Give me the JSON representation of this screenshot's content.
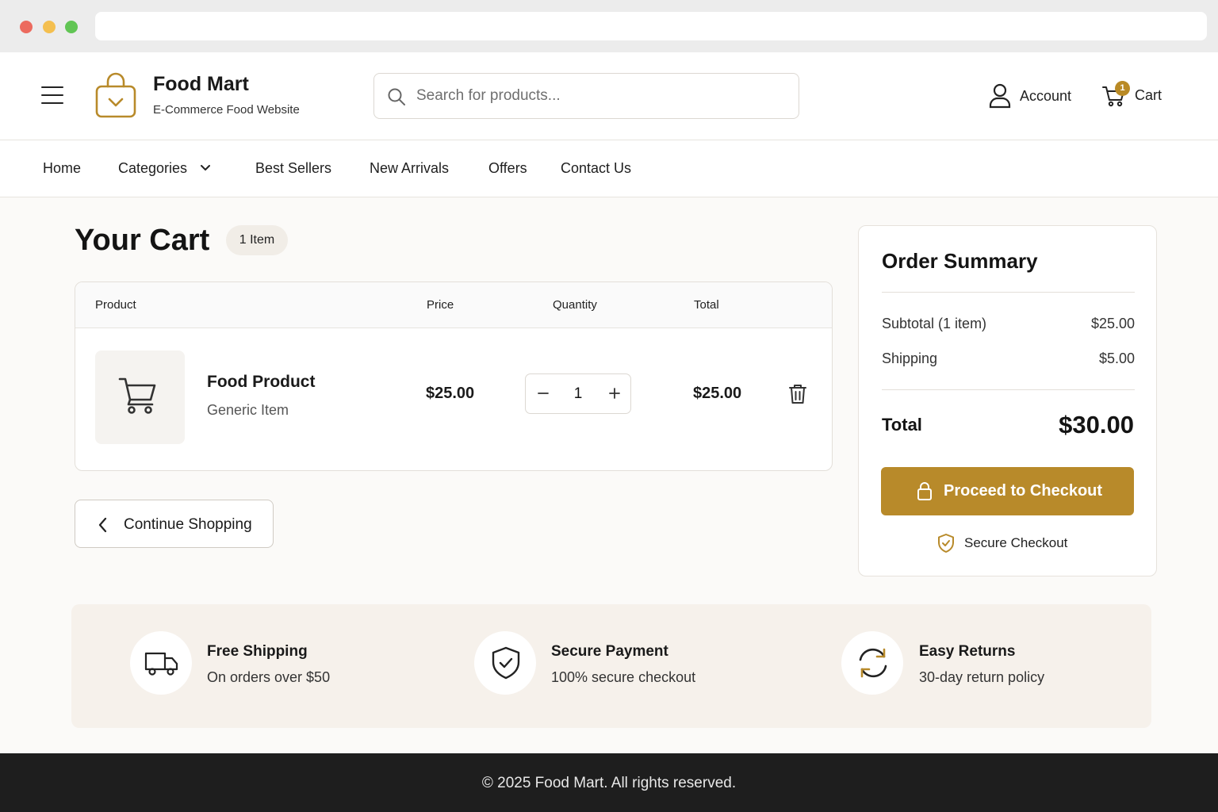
{
  "brand": {
    "name": "Food Mart",
    "tagline": "E-Commerce Food Website",
    "accent_color": "#b88a2a"
  },
  "search": {
    "placeholder": "Search for products...",
    "value": ""
  },
  "header": {
    "account_label": "Account",
    "cart_label": "Cart",
    "cart_count": "1"
  },
  "nav": {
    "items": [
      "Home",
      "Categories",
      "Best Sellers",
      "New Arrivals",
      "Offers",
      "Contact Us"
    ]
  },
  "cart": {
    "title": "Your Cart",
    "item_count_label": "1 Item",
    "columns": [
      "Product",
      "Price",
      "Quantity",
      "Total"
    ],
    "items": [
      {
        "name": "Food Product",
        "subtitle": "Generic Item",
        "price": "$25.00",
        "quantity": "1",
        "total": "$25.00"
      }
    ],
    "continue_label": "Continue Shopping"
  },
  "summary": {
    "title": "Order Summary",
    "subtotal_label": "Subtotal (1 item)",
    "subtotal_value": "$25.00",
    "shipping_label": "Shipping",
    "shipping_value": "$5.00",
    "total_label": "Total",
    "total_value": "$30.00",
    "checkout_label": "Proceed to Checkout",
    "secure_label": "Secure Checkout"
  },
  "features": [
    {
      "title": "Free Shipping",
      "subtitle": "On orders over $50",
      "icon": "truck-icon"
    },
    {
      "title": "Secure Payment",
      "subtitle": "100% secure checkout",
      "icon": "shield-check-icon"
    },
    {
      "title": "Easy Returns",
      "subtitle": "30-day return policy",
      "icon": "refresh-icon"
    }
  ],
  "footer": {
    "text": "© 2025 Food Mart. All rights reserved."
  }
}
